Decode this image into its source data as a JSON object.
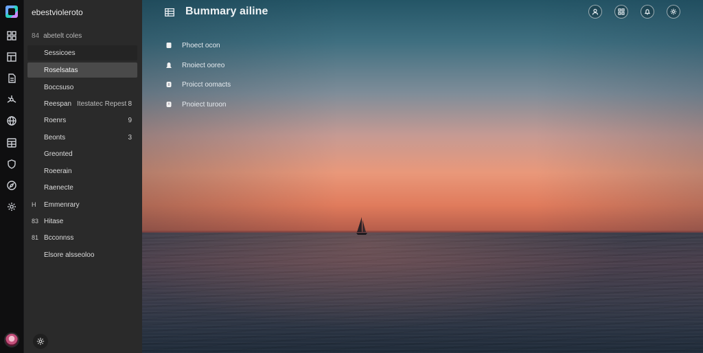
{
  "sidebar": {
    "workspace_name": "ebestvioleroto",
    "section_prefix": "84",
    "section_label": "abetelt coles",
    "items": [
      {
        "label": "Sessicoes",
        "lead": "",
        "trail": "",
        "badge": ""
      },
      {
        "label": "Roselsatas",
        "lead": "",
        "trail": "",
        "badge": ""
      },
      {
        "label": "Boccsuso",
        "lead": "",
        "trail": "",
        "badge": ""
      },
      {
        "label": "Reespan",
        "lead": "",
        "trail": "Itestatec Repest",
        "badge": "8"
      },
      {
        "label": "Roenrs",
        "lead": "",
        "trail": "",
        "badge": "9"
      },
      {
        "label": "Beonts",
        "lead": "",
        "trail": "",
        "badge": "3"
      },
      {
        "label": "Greonted",
        "lead": "",
        "trail": "",
        "badge": ""
      },
      {
        "label": "Roeerain",
        "lead": "",
        "trail": "",
        "badge": ""
      },
      {
        "label": "Raenecte",
        "lead": "",
        "trail": "",
        "badge": ""
      },
      {
        "label": "Emmenrary",
        "lead": "H",
        "trail": "",
        "badge": ""
      },
      {
        "label": "Hitase",
        "lead": "83",
        "trail": "",
        "badge": ""
      },
      {
        "label": "Bcconnss",
        "lead": "81",
        "trail": "",
        "badge": ""
      },
      {
        "label": "Elsore alsseoloo",
        "lead": "",
        "trail": "",
        "badge": ""
      }
    ]
  },
  "rail_icons": [
    "grid-icon",
    "layout-icon",
    "document-icon",
    "network-icon",
    "globe-icon",
    "table-icon",
    "shield-icon",
    "compass-icon",
    "gear-icon"
  ],
  "header": {
    "title": "Bummary ailine",
    "actions": [
      "user-icon",
      "grid-icon",
      "bell-icon",
      "gear-icon"
    ]
  },
  "main_list": [
    {
      "icon": "file-icon",
      "label": "Phoect ocon"
    },
    {
      "icon": "user-icon",
      "label": "Rnoiect ooreo"
    },
    {
      "icon": "info-icon",
      "label": "Proicct oomacts"
    },
    {
      "icon": "clock-icon",
      "label": "Pnoiect turoon"
    }
  ],
  "colors": {
    "sidebar_bg": "#2a2a2a",
    "rail_bg": "#0f0f10",
    "active_item_bg": "#4a4a4a",
    "sky_top": "#245566",
    "sky_horizon": "#e07b5c",
    "sea": "#2b3443"
  }
}
